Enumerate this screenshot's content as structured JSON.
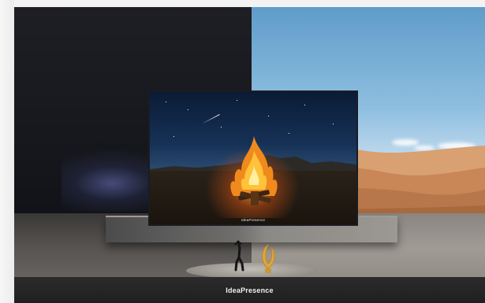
{
  "scene": {
    "tv_brand_label": "IdeaPresence",
    "caption": "IdeaPresence"
  },
  "colors": {
    "left_wall": "#16171c",
    "right_sky": "#8fbfe0",
    "dune": "#c9895a",
    "console": "#7a7875",
    "caption_bar": "#252526"
  }
}
